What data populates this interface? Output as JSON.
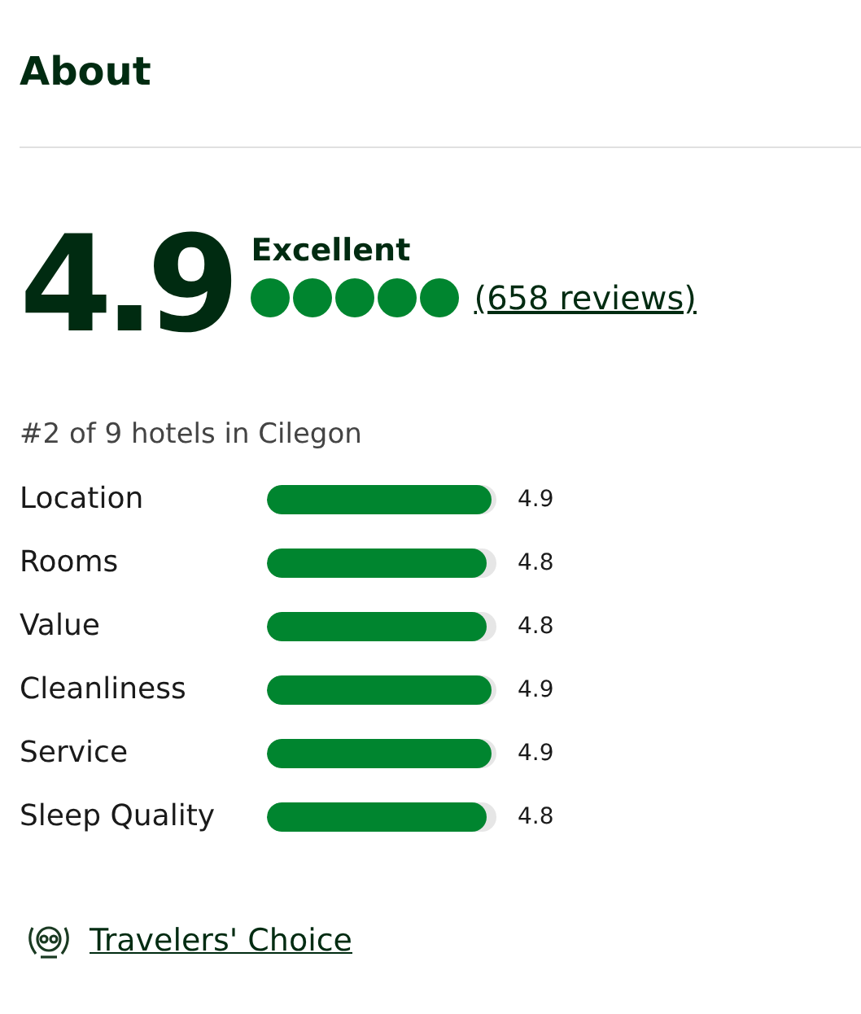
{
  "heading": "About",
  "overall": {
    "score": "4.9",
    "label": "Excellent",
    "stars": 5,
    "reviews": "(658 reviews)"
  },
  "ranking": "#2 of 9 hotels in Cilegon",
  "categories": [
    {
      "name": "Location",
      "level": 0.98,
      "score": "4.9"
    },
    {
      "name": "Rooms",
      "level": 0.96,
      "score": "4.8"
    },
    {
      "name": "Value",
      "level": 0.96,
      "score": "4.8"
    },
    {
      "name": "Cleanliness",
      "level": 0.98,
      "score": "4.9"
    },
    {
      "name": "Service",
      "level": 0.98,
      "score": "4.9"
    },
    {
      "name": "Sleep Quality",
      "level": 0.96,
      "score": "4.8"
    }
  ],
  "award": "Travelers' Choice"
}
